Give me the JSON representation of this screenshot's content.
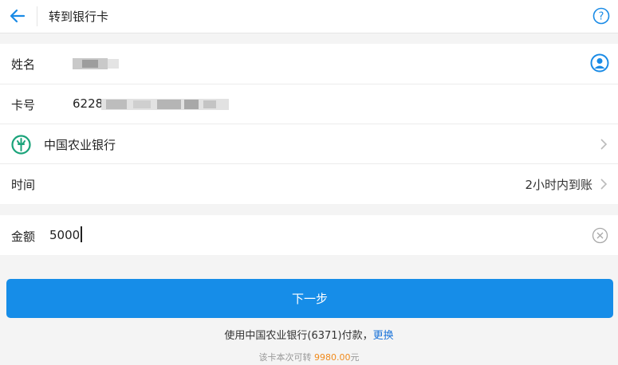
{
  "header": {
    "title": "转到银行卡",
    "back_icon": "arrow-left-icon",
    "help_icon": "question-circle-icon"
  },
  "payee": {
    "name_label": "姓名",
    "name_value_state": "redacted",
    "card_label": "卡号",
    "card_prefix": "6228",
    "card_rest_state": "redacted",
    "contact_icon": "person-circle-icon",
    "bank_name": "中国农业银行",
    "bank_logo": "abc-bank-logo",
    "time_label": "时间",
    "time_value": "2小时内到账"
  },
  "amount": {
    "label": "金额",
    "value": "5000",
    "clear_icon": "clear-circle-icon"
  },
  "next_button": "下一步",
  "pay_with": {
    "text": "使用中国农业银行(6371)付款，",
    "change_link": "更换"
  },
  "limit": {
    "prefix": "该卡本次可转",
    "amount": "9980.00",
    "suffix": "元"
  },
  "colors": {
    "accent": "#168de8",
    "link": "#1a73d9",
    "highlight": "#f08a1c",
    "bank_green": "#1aa37a"
  }
}
